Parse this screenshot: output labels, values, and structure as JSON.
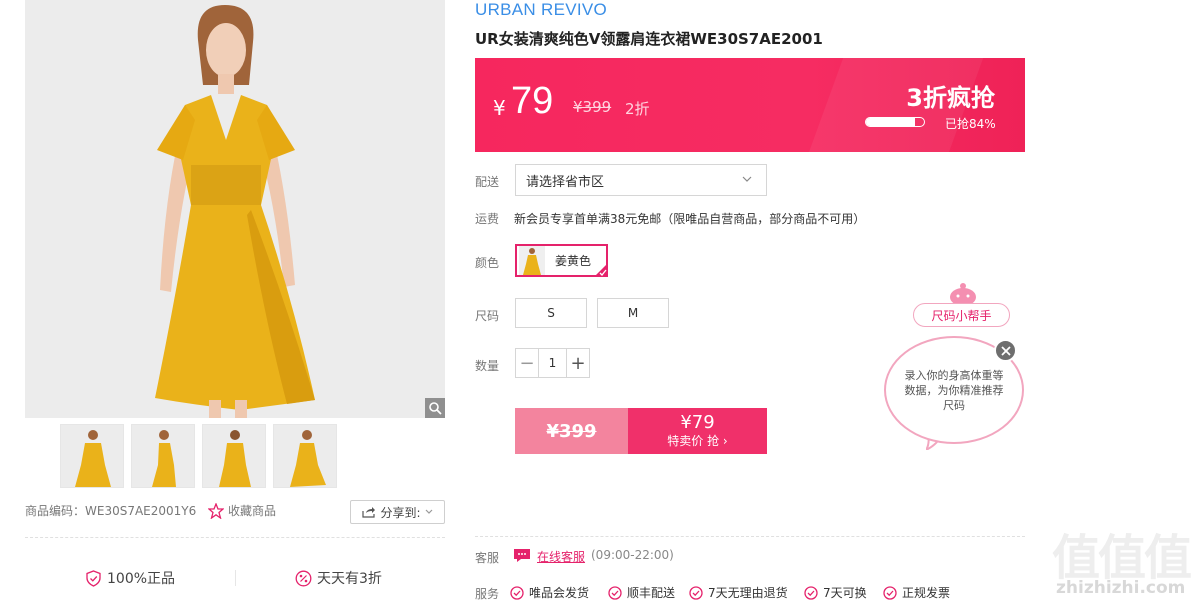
{
  "product": {
    "brand": "URBAN REVIVO",
    "title": "UR女装清爽纯色V领露肩连衣裙WE30S7AE2001",
    "code_label": "商品编码：WE30S7AE2001Y6",
    "favorite_label": "收藏商品",
    "share_label": "分享到:"
  },
  "price": {
    "currency": "¥",
    "current": "79",
    "original": "¥399",
    "discount": "2折",
    "flash_title": "3折疯抢",
    "sold_text": "已抢84%",
    "sold_progress_percent": 84
  },
  "form": {
    "delivery_label": "配送",
    "delivery_value": "请选择省市区",
    "shipping_label": "运费",
    "shipping_text": "新会员专享首单满38元免邮（限唯品自营商品，部分商品不可用）",
    "color_label": "颜色",
    "color_value": "姜黄色",
    "size_label": "尺码",
    "sizes": [
      "S",
      "M"
    ],
    "qty_label": "数量",
    "qty_minus": "−",
    "qty_value": "1",
    "qty_plus": "+"
  },
  "buy": {
    "original_price": "¥399",
    "sale_price": "¥79",
    "sale_label": "特卖价 抢 ›"
  },
  "helper": {
    "pill_label": "尺码小帮手",
    "bubble_text": "录入你的身高体重等数据，为你精准推荐尺码"
  },
  "promises": [
    {
      "label": "100%正品"
    },
    {
      "label": "天天有3折"
    }
  ],
  "service": {
    "cs_label": "客服",
    "cs_link": "在线客服",
    "cs_hours": "(09:00-22:00)",
    "services_label": "服务",
    "items": [
      "唯品会发货",
      "顺丰配送",
      "7天无理由退货",
      "7天可换",
      "正规发票"
    ]
  },
  "watermark": {
    "text": "值值值",
    "url": "zhizhizhi.com"
  },
  "colors": {
    "accent": "#f62c62",
    "pink": "#e5226b",
    "brand_blue": "#3a8ee6",
    "dress": "#eab21a"
  }
}
